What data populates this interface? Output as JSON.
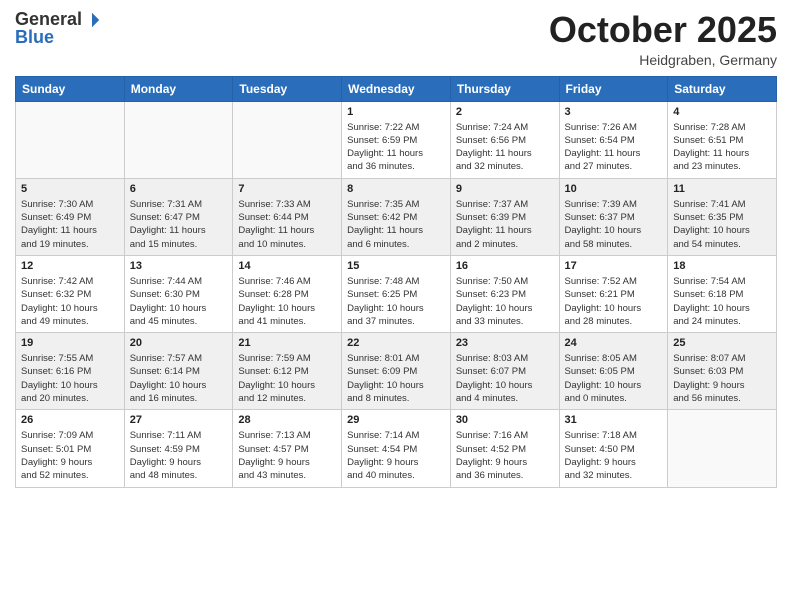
{
  "header": {
    "logo_general": "General",
    "logo_blue": "Blue",
    "month_title": "October 2025",
    "location": "Heidgraben, Germany"
  },
  "days_of_week": [
    "Sunday",
    "Monday",
    "Tuesday",
    "Wednesday",
    "Thursday",
    "Friday",
    "Saturday"
  ],
  "weeks": [
    [
      {
        "day": "",
        "info": ""
      },
      {
        "day": "",
        "info": ""
      },
      {
        "day": "",
        "info": ""
      },
      {
        "day": "1",
        "info": "Sunrise: 7:22 AM\nSunset: 6:59 PM\nDaylight: 11 hours\nand 36 minutes."
      },
      {
        "day": "2",
        "info": "Sunrise: 7:24 AM\nSunset: 6:56 PM\nDaylight: 11 hours\nand 32 minutes."
      },
      {
        "day": "3",
        "info": "Sunrise: 7:26 AM\nSunset: 6:54 PM\nDaylight: 11 hours\nand 27 minutes."
      },
      {
        "day": "4",
        "info": "Sunrise: 7:28 AM\nSunset: 6:51 PM\nDaylight: 11 hours\nand 23 minutes."
      }
    ],
    [
      {
        "day": "5",
        "info": "Sunrise: 7:30 AM\nSunset: 6:49 PM\nDaylight: 11 hours\nand 19 minutes."
      },
      {
        "day": "6",
        "info": "Sunrise: 7:31 AM\nSunset: 6:47 PM\nDaylight: 11 hours\nand 15 minutes."
      },
      {
        "day": "7",
        "info": "Sunrise: 7:33 AM\nSunset: 6:44 PM\nDaylight: 11 hours\nand 10 minutes."
      },
      {
        "day": "8",
        "info": "Sunrise: 7:35 AM\nSunset: 6:42 PM\nDaylight: 11 hours\nand 6 minutes."
      },
      {
        "day": "9",
        "info": "Sunrise: 7:37 AM\nSunset: 6:39 PM\nDaylight: 11 hours\nand 2 minutes."
      },
      {
        "day": "10",
        "info": "Sunrise: 7:39 AM\nSunset: 6:37 PM\nDaylight: 10 hours\nand 58 minutes."
      },
      {
        "day": "11",
        "info": "Sunrise: 7:41 AM\nSunset: 6:35 PM\nDaylight: 10 hours\nand 54 minutes."
      }
    ],
    [
      {
        "day": "12",
        "info": "Sunrise: 7:42 AM\nSunset: 6:32 PM\nDaylight: 10 hours\nand 49 minutes."
      },
      {
        "day": "13",
        "info": "Sunrise: 7:44 AM\nSunset: 6:30 PM\nDaylight: 10 hours\nand 45 minutes."
      },
      {
        "day": "14",
        "info": "Sunrise: 7:46 AM\nSunset: 6:28 PM\nDaylight: 10 hours\nand 41 minutes."
      },
      {
        "day": "15",
        "info": "Sunrise: 7:48 AM\nSunset: 6:25 PM\nDaylight: 10 hours\nand 37 minutes."
      },
      {
        "day": "16",
        "info": "Sunrise: 7:50 AM\nSunset: 6:23 PM\nDaylight: 10 hours\nand 33 minutes."
      },
      {
        "day": "17",
        "info": "Sunrise: 7:52 AM\nSunset: 6:21 PM\nDaylight: 10 hours\nand 28 minutes."
      },
      {
        "day": "18",
        "info": "Sunrise: 7:54 AM\nSunset: 6:18 PM\nDaylight: 10 hours\nand 24 minutes."
      }
    ],
    [
      {
        "day": "19",
        "info": "Sunrise: 7:55 AM\nSunset: 6:16 PM\nDaylight: 10 hours\nand 20 minutes."
      },
      {
        "day": "20",
        "info": "Sunrise: 7:57 AM\nSunset: 6:14 PM\nDaylight: 10 hours\nand 16 minutes."
      },
      {
        "day": "21",
        "info": "Sunrise: 7:59 AM\nSunset: 6:12 PM\nDaylight: 10 hours\nand 12 minutes."
      },
      {
        "day": "22",
        "info": "Sunrise: 8:01 AM\nSunset: 6:09 PM\nDaylight: 10 hours\nand 8 minutes."
      },
      {
        "day": "23",
        "info": "Sunrise: 8:03 AM\nSunset: 6:07 PM\nDaylight: 10 hours\nand 4 minutes."
      },
      {
        "day": "24",
        "info": "Sunrise: 8:05 AM\nSunset: 6:05 PM\nDaylight: 10 hours\nand 0 minutes."
      },
      {
        "day": "25",
        "info": "Sunrise: 8:07 AM\nSunset: 6:03 PM\nDaylight: 9 hours\nand 56 minutes."
      }
    ],
    [
      {
        "day": "26",
        "info": "Sunrise: 7:09 AM\nSunset: 5:01 PM\nDaylight: 9 hours\nand 52 minutes."
      },
      {
        "day": "27",
        "info": "Sunrise: 7:11 AM\nSunset: 4:59 PM\nDaylight: 9 hours\nand 48 minutes."
      },
      {
        "day": "28",
        "info": "Sunrise: 7:13 AM\nSunset: 4:57 PM\nDaylight: 9 hours\nand 43 minutes."
      },
      {
        "day": "29",
        "info": "Sunrise: 7:14 AM\nSunset: 4:54 PM\nDaylight: 9 hours\nand 40 minutes."
      },
      {
        "day": "30",
        "info": "Sunrise: 7:16 AM\nSunset: 4:52 PM\nDaylight: 9 hours\nand 36 minutes."
      },
      {
        "day": "31",
        "info": "Sunrise: 7:18 AM\nSunset: 4:50 PM\nDaylight: 9 hours\nand 32 minutes."
      },
      {
        "day": "",
        "info": ""
      }
    ]
  ]
}
